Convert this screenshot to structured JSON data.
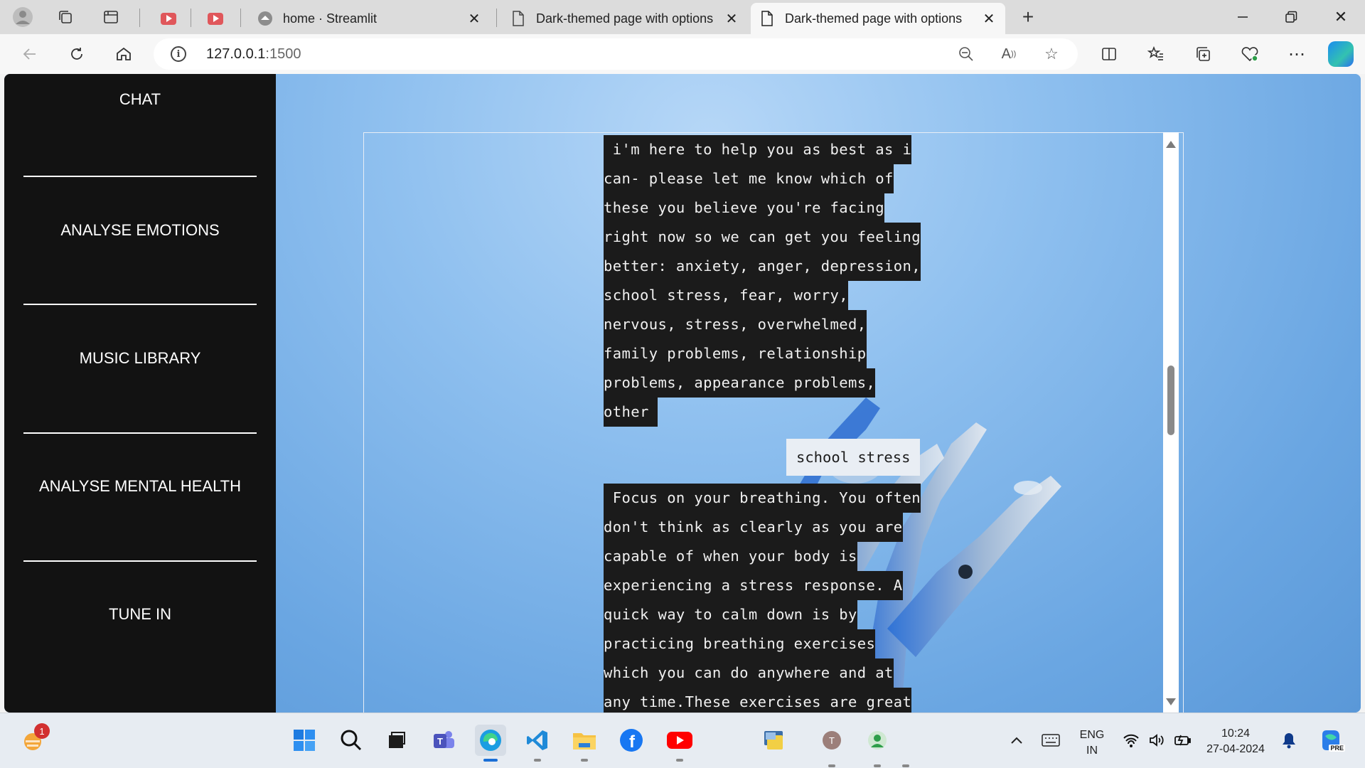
{
  "browser": {
    "tabs": [
      {
        "title": "",
        "icon": "youtube-icon"
      },
      {
        "title": "",
        "icon": "youtube-icon"
      },
      {
        "title": "home · Streamlit",
        "icon": "streamlit-icon"
      },
      {
        "title": "Dark-themed page with options",
        "icon": "page-icon"
      },
      {
        "title": "Dark-themed page with options",
        "icon": "page-icon",
        "active": true
      }
    ],
    "url_host": "127.0.0.1",
    "url_port": ":1500"
  },
  "sidebar": {
    "items": [
      {
        "label": "CHAT"
      },
      {
        "label": "ANALYSE EMOTIONS"
      },
      {
        "label": "MUSIC LIBRARY"
      },
      {
        "label": "ANALYSE MENTAL HEALTH"
      },
      {
        "label": "TUNE IN"
      }
    ]
  },
  "chat": {
    "bot_message_1": [
      " i'm here to help you as best as i",
      "can- please let me know which of",
      "these you believe you're facing",
      "right now so we can get you feeling",
      "better: anxiety, anger, depression,",
      "school stress, fear, worry,",
      "nervous, stress, overwhelmed,",
      "family problems, relationship",
      "problems, appearance problems,",
      "other "
    ],
    "user_message": "school stress",
    "bot_message_2": [
      " Focus on your breathing. You often",
      "don't think as clearly as you are",
      "capable of when your body is",
      "experiencing a stress response. A",
      "quick way to calm down is by",
      "practicing breathing exercises",
      "which you can do anywhere and at",
      "any time.These exercises are great"
    ]
  },
  "taskbar": {
    "notification_count": "1",
    "language": "ENG",
    "region": "IN",
    "time": "10:24",
    "date": "27-04-2024",
    "copilot_badge": "PRE"
  },
  "colors": {
    "sidebar_bg": "#121212",
    "bot_bubble_bg": "#1b1b1b",
    "user_bubble_bg": "#e9eef4",
    "page_bg": "#7fb7ea"
  }
}
